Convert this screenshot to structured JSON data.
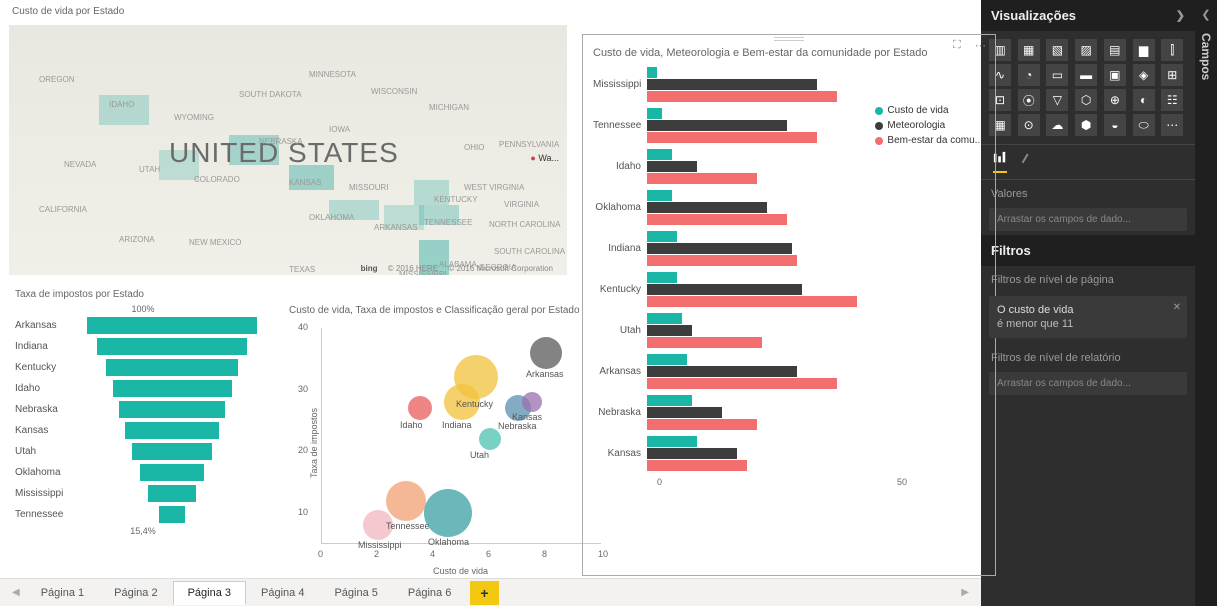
{
  "map": {
    "title": "Custo de vida por Estado",
    "center_label": "UNITED STATES",
    "attribution": {
      "left": "© 2016 HERE",
      "right": "© 2016 Microsoft Corporation",
      "logo": "bing"
    },
    "states": [
      "OREGON",
      "IDAHO",
      "WYOMING",
      "MINNESOTA",
      "WISCONSIN",
      "MICHIGAN",
      "SOUTH DAKOTA",
      "NEVADA",
      "UTAH",
      "COLORADO",
      "NEBRASKA",
      "IOWA",
      "OHIO",
      "PENNSYLVANIA",
      "KANSAS",
      "MISSOURI",
      "WEST VIRGINIA",
      "VIRGINIA",
      "CALIFORNIA",
      "ARIZONA",
      "NEW MEXICO",
      "OKLAHOMA",
      "ARKANSAS",
      "TENNESSEE",
      "KENTUCKY",
      "NORTH CAROLINA",
      "SOUTH CAROLINA",
      "TEXAS",
      "MISSISSIPPI",
      "ALABAMA",
      "GEORGIA"
    ],
    "washington_marker": "Wa..."
  },
  "funnel": {
    "title": "Taxa de impostos por Estado",
    "top_label": "100%",
    "bottom_label": "15,4%",
    "items": [
      {
        "label": "Arkansas",
        "pct": 100
      },
      {
        "label": "Indiana",
        "pct": 88
      },
      {
        "label": "Kentucky",
        "pct": 78
      },
      {
        "label": "Idaho",
        "pct": 70
      },
      {
        "label": "Nebraska",
        "pct": 62
      },
      {
        "label": "Kansas",
        "pct": 55
      },
      {
        "label": "Utah",
        "pct": 47
      },
      {
        "label": "Oklahoma",
        "pct": 38
      },
      {
        "label": "Mississippi",
        "pct": 28
      },
      {
        "label": "Tennessee",
        "pct": 15
      }
    ]
  },
  "scatter": {
    "title": "Custo de vida, Taxa de impostos e Classificação geral por Estado",
    "xlabel": "Custo de vida",
    "ylabel": "Taxa de impostos",
    "x_ticks": [
      0,
      2,
      4,
      6,
      8,
      10
    ],
    "y_ticks": [
      10,
      20,
      30,
      40
    ]
  },
  "bar3": {
    "title": "Custo de vida, Meteorologia e Bem-estar da comunidade por Estado",
    "legend": [
      {
        "label": "Custo de vida",
        "color": "#1ab6a6"
      },
      {
        "label": "Meteorologia",
        "color": "#3d3d3d"
      },
      {
        "label": "Bem-estar da comu...",
        "color": "#f36f6f"
      }
    ],
    "axis": [
      0,
      50
    ],
    "rows": [
      {
        "cat": "Mississippi",
        "v": [
          2,
          34,
          38
        ]
      },
      {
        "cat": "Tennessee",
        "v": [
          3,
          28,
          34
        ]
      },
      {
        "cat": "Idaho",
        "v": [
          5,
          10,
          22
        ]
      },
      {
        "cat": "Oklahoma",
        "v": [
          5,
          24,
          28
        ]
      },
      {
        "cat": "Indiana",
        "v": [
          6,
          29,
          30
        ]
      },
      {
        "cat": "Kentucky",
        "v": [
          6,
          31,
          42
        ]
      },
      {
        "cat": "Utah",
        "v": [
          7,
          9,
          23
        ]
      },
      {
        "cat": "Arkansas",
        "v": [
          8,
          30,
          38
        ]
      },
      {
        "cat": "Nebraska",
        "v": [
          9,
          15,
          22
        ]
      },
      {
        "cat": "Kansas",
        "v": [
          10,
          18,
          20
        ]
      }
    ]
  },
  "tabs": {
    "items": [
      "Página 1",
      "Página 2",
      "Página 3",
      "Página 4",
      "Página 5",
      "Página 6"
    ],
    "active": 2,
    "add": "+"
  },
  "panel": {
    "viz_title": "Visualizações",
    "campos_title": "Campos",
    "values_label": "Valores",
    "values_placeholder": "Arrastar os campos de dado...",
    "filters_title": "Filtros",
    "page_filters_label": "Filtros de nível de página",
    "report_filters_label": "Filtros de nível de relatório",
    "report_filters_placeholder": "Arrastar os campos de dado...",
    "filter_card": {
      "name": "O custo de vida",
      "cond": "é menor que 11"
    }
  },
  "chart_data": [
    {
      "type": "bar",
      "title": "Taxa de impostos por Estado",
      "orientation": "funnel",
      "categories": [
        "Arkansas",
        "Indiana",
        "Kentucky",
        "Idaho",
        "Nebraska",
        "Kansas",
        "Utah",
        "Oklahoma",
        "Mississippi",
        "Tennessee"
      ],
      "values": [
        100,
        88,
        78,
        70,
        62,
        55,
        47,
        38,
        28,
        15.4
      ],
      "unit": "%"
    },
    {
      "type": "scatter",
      "title": "Custo de vida, Taxa de impostos e Classificação geral por Estado",
      "xlabel": "Custo de vida",
      "ylabel": "Taxa de impostos",
      "xlim": [
        0,
        10
      ],
      "ylim": [
        5,
        40
      ],
      "points": [
        {
          "label": "Mississippi",
          "x": 2,
          "y": 8,
          "size": 30,
          "color": "#f2b6c0"
        },
        {
          "label": "Tennessee",
          "x": 3,
          "y": 12,
          "size": 40,
          "color": "#f0a074"
        },
        {
          "label": "Oklahoma",
          "x": 4.5,
          "y": 10,
          "size": 48,
          "color": "#3a9fa3"
        },
        {
          "label": "Idaho",
          "x": 3.5,
          "y": 27,
          "size": 24,
          "color": "#e85b5b"
        },
        {
          "label": "Indiana",
          "x": 5,
          "y": 28,
          "size": 36,
          "color": "#f2c23b"
        },
        {
          "label": "Kentucky",
          "x": 5.5,
          "y": 32,
          "size": 44,
          "color": "#f2c23b"
        },
        {
          "label": "Utah",
          "x": 6,
          "y": 22,
          "size": 22,
          "color": "#4cc0b0"
        },
        {
          "label": "Nebraska",
          "x": 7,
          "y": 27,
          "size": 26,
          "color": "#5a8fb0"
        },
        {
          "label": "Kansas",
          "x": 7.5,
          "y": 28,
          "size": 20,
          "color": "#9a6fb0"
        },
        {
          "label": "Arkansas",
          "x": 8,
          "y": 36,
          "size": 32,
          "color": "#5a5a5a"
        }
      ]
    },
    {
      "type": "bar",
      "title": "Custo de vida, Meteorologia e Bem-estar da comunidade por Estado",
      "orientation": "horizontal",
      "categories": [
        "Mississippi",
        "Tennessee",
        "Idaho",
        "Oklahoma",
        "Indiana",
        "Kentucky",
        "Utah",
        "Arkansas",
        "Nebraska",
        "Kansas"
      ],
      "series": [
        {
          "name": "Custo de vida",
          "values": [
            2,
            3,
            5,
            5,
            6,
            6,
            7,
            8,
            9,
            10
          ],
          "color": "#1ab6a6"
        },
        {
          "name": "Meteorologia",
          "values": [
            34,
            28,
            10,
            24,
            29,
            31,
            9,
            30,
            15,
            18
          ],
          "color": "#3d3d3d"
        },
        {
          "name": "Bem-estar da comunidade",
          "values": [
            38,
            34,
            22,
            28,
            30,
            42,
            23,
            38,
            22,
            20
          ],
          "color": "#f36f6f"
        }
      ],
      "xlim": [
        0,
        50
      ]
    }
  ]
}
